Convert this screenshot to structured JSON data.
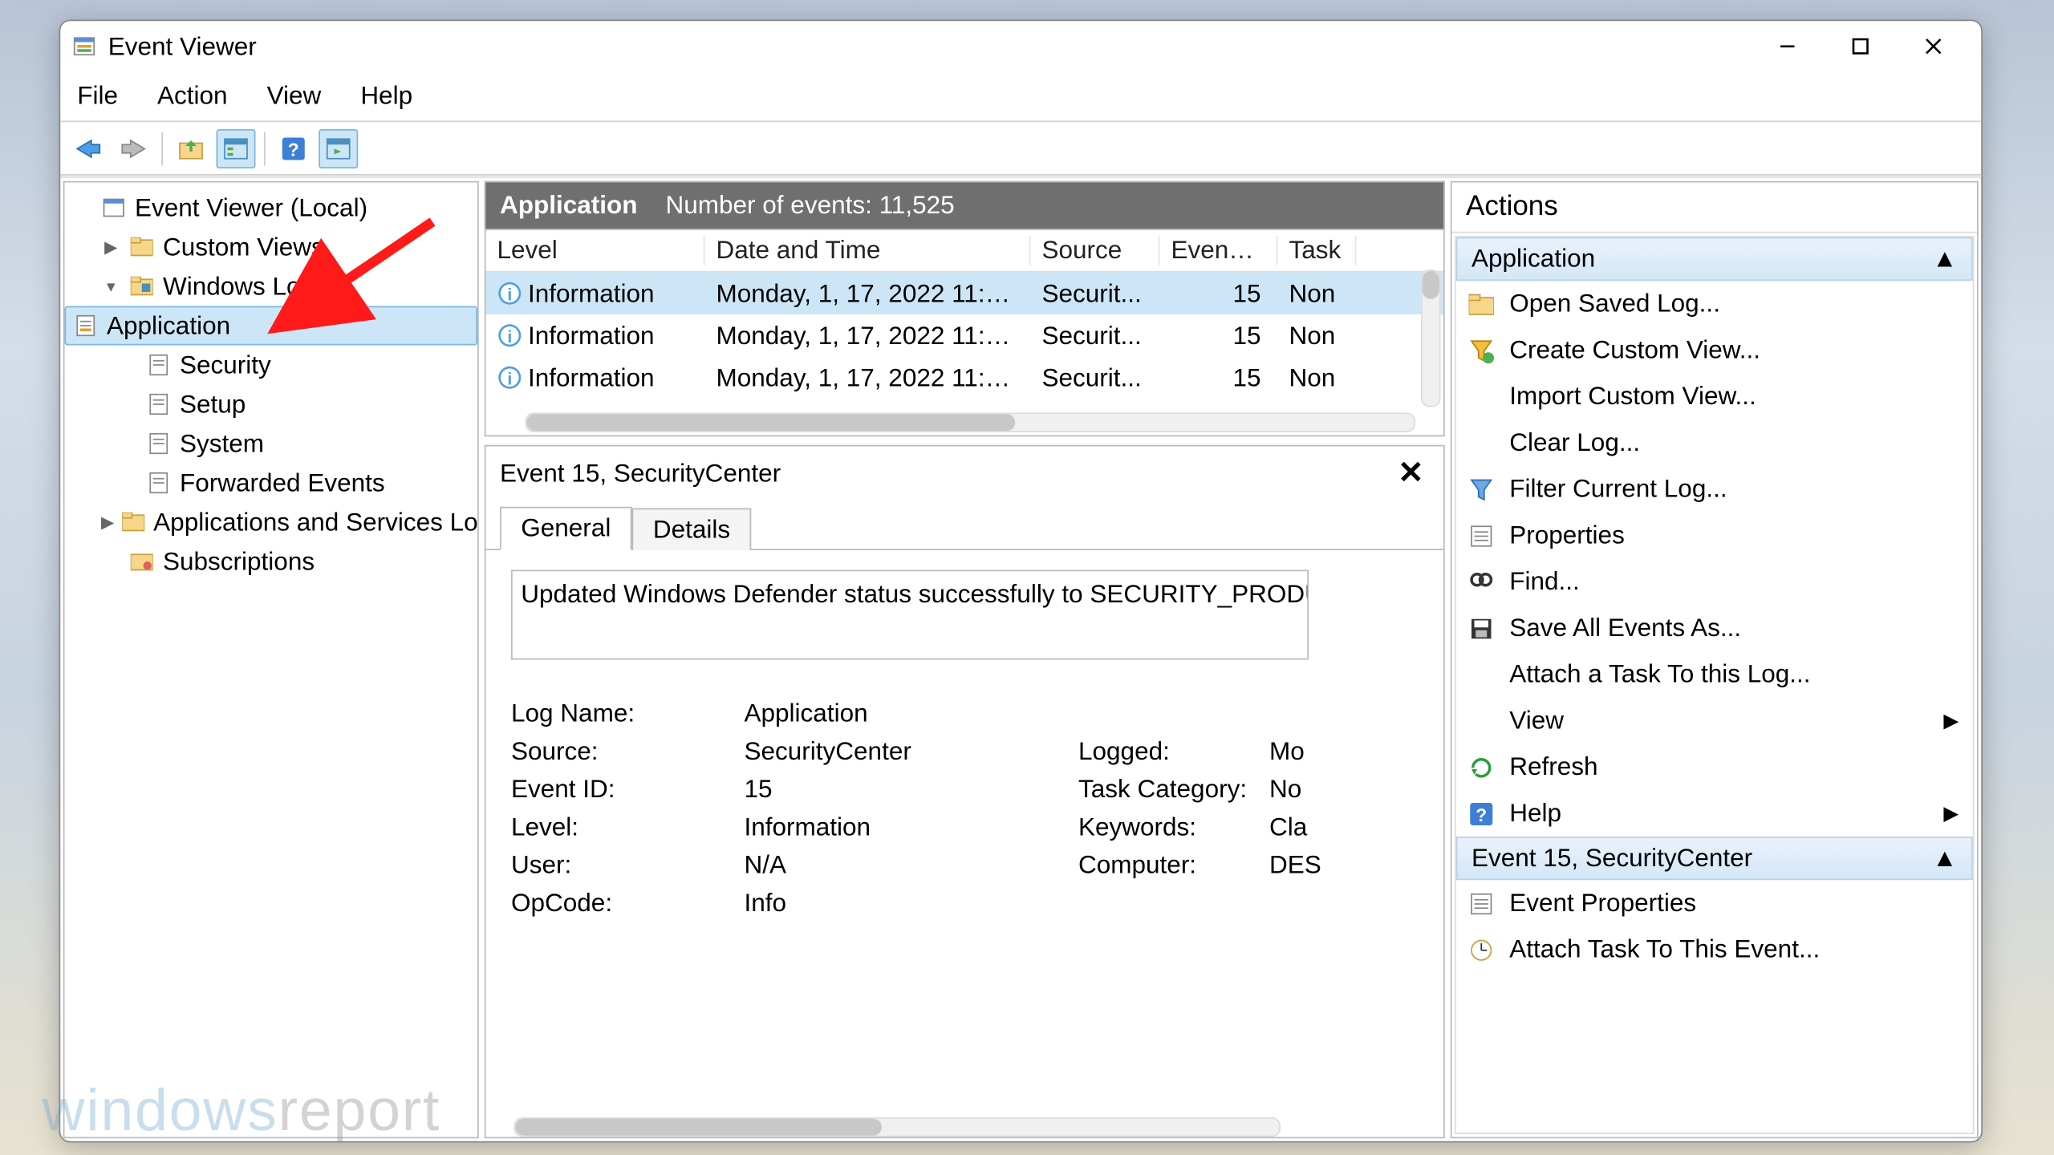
{
  "window": {
    "title": "Event Viewer"
  },
  "menu": {
    "file": "File",
    "action": "Action",
    "view": "View",
    "help": "Help"
  },
  "tree": {
    "root": "Event Viewer (Local)",
    "custom_views": "Custom Views",
    "windows_logs": "Windows Logs",
    "children": {
      "application": "Application",
      "security": "Security",
      "setup": "Setup",
      "system": "System",
      "forwarded": "Forwarded Events"
    },
    "apps_services": "Applications and Services Lo",
    "subscriptions": "Subscriptions"
  },
  "list": {
    "title": "Application",
    "count_label": "Number of events: 11,525",
    "columns": {
      "level": "Level",
      "date": "Date and Time",
      "source": "Source",
      "id": "Event ID",
      "task": "Task"
    },
    "rows": [
      {
        "level": "Information",
        "date": "Monday, 1, 17, 2022 11:2...",
        "source": "Securit...",
        "id": "15",
        "task": "Non"
      },
      {
        "level": "Information",
        "date": "Monday, 1, 17, 2022 11:2...",
        "source": "Securit...",
        "id": "15",
        "task": "Non"
      },
      {
        "level": "Information",
        "date": "Monday, 1, 17, 2022 11:2...",
        "source": "Securit...",
        "id": "15",
        "task": "Non"
      }
    ]
  },
  "detail": {
    "title": "Event 15, SecurityCenter",
    "tabs": {
      "general": "General",
      "details": "Details"
    },
    "message": "Updated Windows Defender status successfully to SECURITY_PRODUC",
    "props": {
      "log_name_l": "Log Name:",
      "log_name_v": "Application",
      "source_l": "Source:",
      "source_v": "SecurityCenter",
      "logged_l": "Logged:",
      "logged_v": "Mo",
      "event_id_l": "Event ID:",
      "event_id_v": "15",
      "task_cat_l": "Task Category:",
      "task_cat_v": "No",
      "level_l": "Level:",
      "level_v": "Information",
      "keywords_l": "Keywords:",
      "keywords_v": "Cla",
      "user_l": "User:",
      "user_v": "N/A",
      "computer_l": "Computer:",
      "computer_v": "DES",
      "opcode_l": "OpCode:",
      "opcode_v": "Info"
    }
  },
  "actions": {
    "title": "Actions",
    "section1": "Application",
    "items1": [
      {
        "key": "open_saved",
        "label": "Open Saved Log...",
        "icon": "folder"
      },
      {
        "key": "create_custom",
        "label": "Create Custom View...",
        "icon": "filter-new"
      },
      {
        "key": "import_custom",
        "label": "Import Custom View...",
        "icon": ""
      },
      {
        "key": "clear_log",
        "label": "Clear Log...",
        "icon": ""
      },
      {
        "key": "filter_current",
        "label": "Filter Current Log...",
        "icon": "filter"
      },
      {
        "key": "properties",
        "label": "Properties",
        "icon": "props"
      },
      {
        "key": "find",
        "label": "Find...",
        "icon": "find"
      },
      {
        "key": "save_all",
        "label": "Save All Events As...",
        "icon": "save"
      },
      {
        "key": "attach_task_log",
        "label": "Attach a Task To this Log...",
        "icon": ""
      },
      {
        "key": "view",
        "label": "View",
        "icon": "",
        "sub": true
      },
      {
        "key": "refresh",
        "label": "Refresh",
        "icon": "refresh"
      },
      {
        "key": "help",
        "label": "Help",
        "icon": "help",
        "sub": true
      }
    ],
    "section2": "Event 15, SecurityCenter",
    "items2": [
      {
        "key": "event_properties",
        "label": "Event Properties",
        "icon": "props"
      },
      {
        "key": "attach_task_event",
        "label": "Attach Task To This Event...",
        "icon": "task"
      }
    ]
  },
  "watermark": {
    "a": "windows",
    "b": "report"
  }
}
